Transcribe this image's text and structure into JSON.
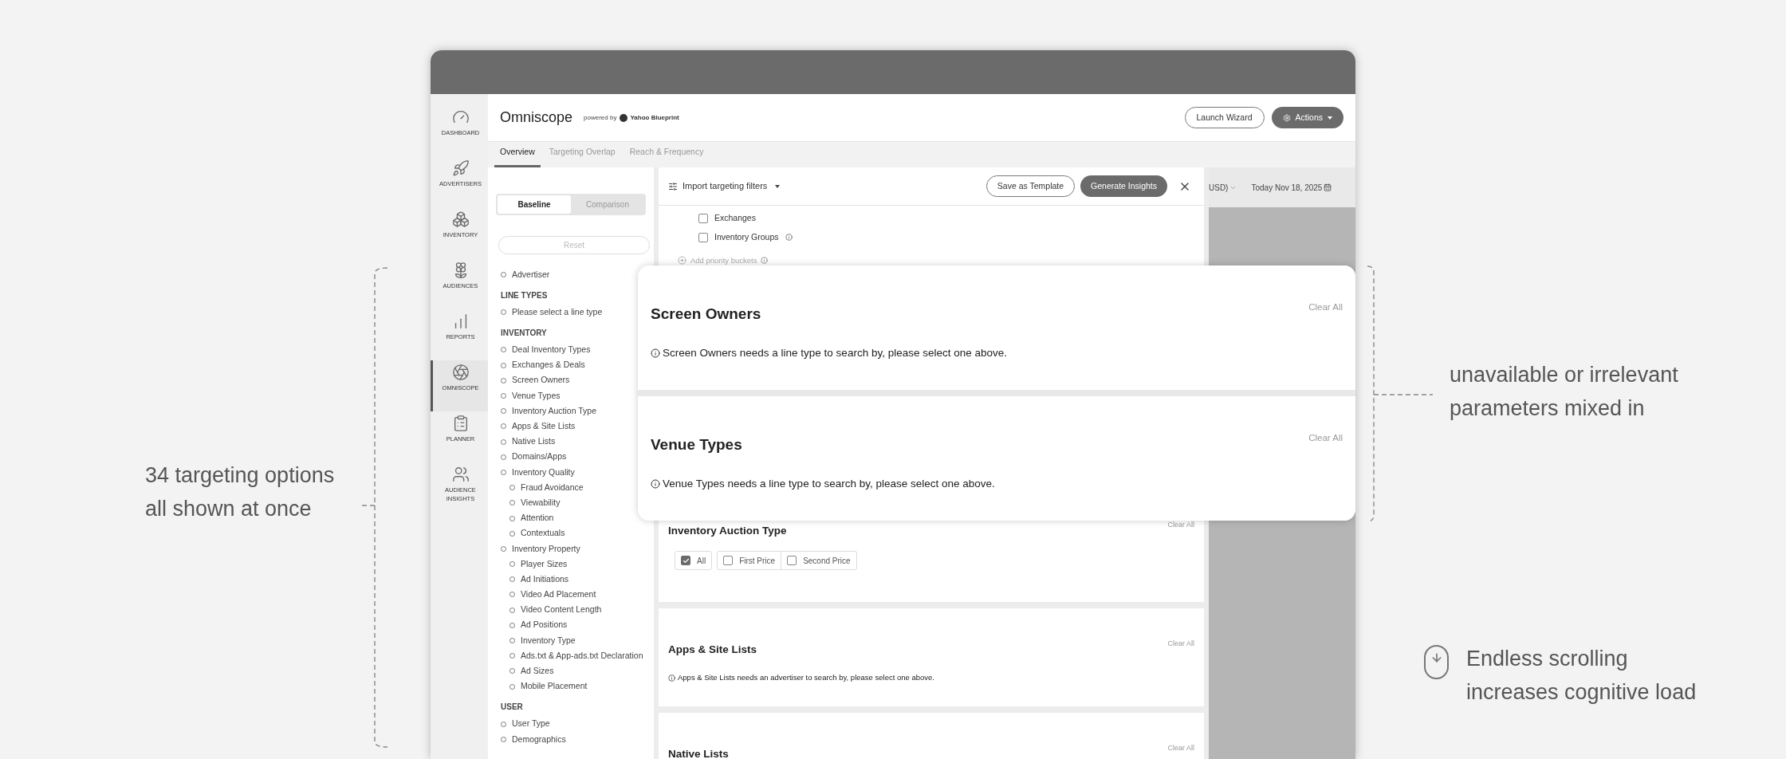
{
  "annotations": {
    "left": "34 targeting options\nall shown at once",
    "right": "unavailable or irrelevant\nparameters mixed in",
    "bottom_right": "Endless scrolling\nincreases cognitive load"
  },
  "nav": [
    {
      "label": "DASHBOARD",
      "selected": false
    },
    {
      "label": "ADVERTISERS",
      "selected": false
    },
    {
      "label": "INVENTORY",
      "selected": false
    },
    {
      "label": "AUDIENCES",
      "selected": false
    },
    {
      "label": "REPORTS",
      "selected": false
    },
    {
      "label": "OMNISCOPE",
      "selected": true
    },
    {
      "label": "PLANNER",
      "selected": false
    },
    {
      "label": "AUDIENCE INSIGHTS",
      "selected": false
    }
  ],
  "header": {
    "title": "Omniscope",
    "powered_by": "powered by",
    "brand": "Yahoo Blueprint",
    "launch": "Launch Wizard",
    "actions": "Actions"
  },
  "tabs": [
    {
      "label": "Overview",
      "selected": true
    },
    {
      "label": "Targeting Overlap",
      "selected": false
    },
    {
      "label": "Reach & Frequency",
      "selected": false
    }
  ],
  "sidebar": {
    "toggle": [
      {
        "label": "Baseline",
        "selected": true
      },
      {
        "label": "Comparison",
        "selected": false
      }
    ],
    "reset": {
      "label": "Reset",
      "disabled": true
    },
    "groups": [
      {
        "items": [
          {
            "label": "Advertiser"
          }
        ]
      },
      {
        "heading": "LINE TYPES",
        "items": [
          {
            "label": "Please select a line type"
          }
        ]
      },
      {
        "heading": "INVENTORY",
        "items": [
          {
            "label": "Deal Inventory Types"
          },
          {
            "label": "Exchanges & Deals"
          },
          {
            "label": "Screen Owners"
          },
          {
            "label": "Venue Types"
          },
          {
            "label": "Inventory Auction Type"
          },
          {
            "label": "Apps & Site Lists"
          },
          {
            "label": "Native Lists"
          },
          {
            "label": "Domains/Apps"
          },
          {
            "label": "Inventory Quality",
            "children": [
              {
                "label": "Fraud Avoidance"
              },
              {
                "label": "Viewability"
              },
              {
                "label": "Attention"
              },
              {
                "label": "Contextuals"
              }
            ]
          },
          {
            "label": "Inventory Property",
            "children": [
              {
                "label": "Player Sizes"
              },
              {
                "label": "Ad Initiations"
              },
              {
                "label": "Video Ad Placement"
              },
              {
                "label": "Video Content Length"
              },
              {
                "label": "Ad Positions"
              },
              {
                "label": "Inventory Type"
              },
              {
                "label": "Ads.txt & App-ads.txt Declaration"
              },
              {
                "label": "Ad Sizes"
              },
              {
                "label": "Mobile Placement"
              }
            ]
          }
        ]
      },
      {
        "heading": "USER",
        "items": [
          {
            "label": "User Type"
          },
          {
            "label": "Demographics"
          }
        ]
      }
    ]
  },
  "toolbar": {
    "import": "Import targeting filters",
    "save": "Save as Template",
    "generate": "Generate Insights"
  },
  "filters": {
    "checkboxes": [
      {
        "label": "Exchanges",
        "checked": false,
        "info": false
      },
      {
        "label": "Inventory Groups",
        "checked": false,
        "info": true
      }
    ],
    "add_link": "Add priority buckets",
    "sections": [
      {
        "kind": "options",
        "title": "Inventory Auction Type",
        "clear": "Clear All",
        "options": [
          {
            "label": "All",
            "checked": true
          },
          {
            "label": "First Price",
            "checked": false
          },
          {
            "label": "Second Price",
            "checked": false
          }
        ]
      },
      {
        "kind": "notice",
        "title": "Apps & Site Lists",
        "clear": "Clear All",
        "notice": "Apps & Site Lists needs an advertiser to search by, please select one above."
      },
      {
        "kind": "notice",
        "title": "Native Lists",
        "clear": "Clear All"
      }
    ]
  },
  "right_area": {
    "currency": "USD)",
    "date": "Today Nov 18, 2025"
  },
  "overlay": {
    "sections": [
      {
        "title": "Screen Owners",
        "clear": "Clear All",
        "notice": "Screen Owners needs a line type to search by, please select one above."
      },
      {
        "title": "Venue Types",
        "clear": "Clear All",
        "notice": "Venue Types needs a line type to search by, please select one above."
      }
    ]
  }
}
